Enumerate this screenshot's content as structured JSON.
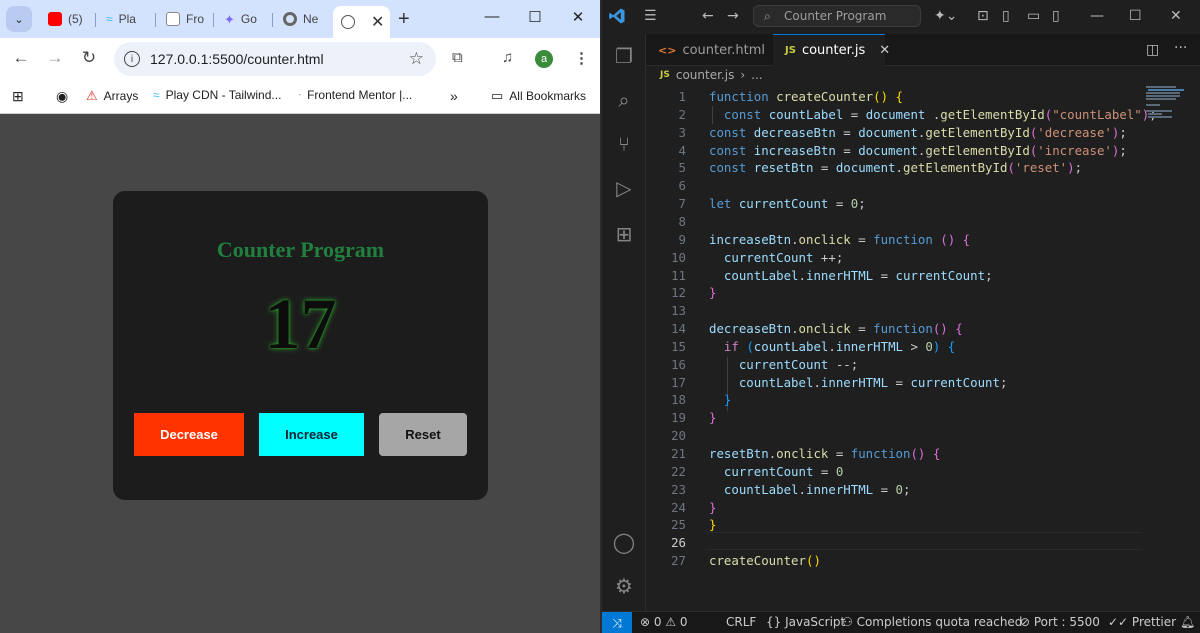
{
  "browser": {
    "tabs": [
      {
        "label": "(5)"
      },
      {
        "label": "Pla"
      },
      {
        "label": "Fro"
      },
      {
        "label": "Go"
      },
      {
        "label": "Ne"
      },
      {
        "label": ""
      }
    ],
    "url": "127.0.0.1:5500/counter.html",
    "avatar_letter": "a",
    "bookmarks": [
      "Arrays",
      "Play CDN - Tailwind...",
      "Frontend Mentor |...",
      "All Bookmarks"
    ],
    "overflow_label": "»"
  },
  "page": {
    "title": "Counter Program",
    "count": "17",
    "buttons": {
      "decrease": "Decrease",
      "increase": "Increase",
      "reset": "Reset"
    }
  },
  "vscode": {
    "search_placeholder": "Counter Program",
    "tabs": [
      {
        "icon": "<>",
        "label": "counter.html"
      },
      {
        "icon": "JS",
        "label": "counter.js"
      }
    ],
    "breadcrumb": {
      "icon": "JS",
      "file": "counter.js",
      "rest": "..."
    },
    "current_line": 26,
    "code_lines": [
      [
        [
          "kw",
          "function "
        ],
        [
          "fn",
          "createCounter"
        ],
        [
          "p1",
          "() {"
        ]
      ],
      [
        [
          "",
          "  "
        ],
        [
          "kw",
          "const "
        ],
        [
          "var",
          "countLabel"
        ],
        [
          "",
          " = "
        ],
        [
          "var",
          "document"
        ],
        [
          "",
          " ."
        ],
        [
          "fn",
          "getElementById"
        ],
        [
          "p2",
          "("
        ],
        [
          "str",
          "\"countLabel\""
        ],
        [
          "p2",
          ")"
        ],
        [
          "",
          ";"
        ]
      ],
      [
        [
          "kw",
          "const "
        ],
        [
          "var",
          "decreaseBtn"
        ],
        [
          "",
          " = "
        ],
        [
          "var",
          "document"
        ],
        [
          "",
          "."
        ],
        [
          "fn",
          "getElementById"
        ],
        [
          "p2",
          "("
        ],
        [
          "str",
          "'decrease'"
        ],
        [
          "p2",
          ")"
        ],
        [
          "",
          ";"
        ]
      ],
      [
        [
          "kw",
          "const "
        ],
        [
          "var",
          "increaseBtn"
        ],
        [
          "",
          " = "
        ],
        [
          "var",
          "document"
        ],
        [
          "",
          "."
        ],
        [
          "fn",
          "getElementById"
        ],
        [
          "p2",
          "("
        ],
        [
          "str",
          "'increase'"
        ],
        [
          "p2",
          ")"
        ],
        [
          "",
          ";"
        ]
      ],
      [
        [
          "kw",
          "const "
        ],
        [
          "var",
          "resetBtn"
        ],
        [
          "",
          " = "
        ],
        [
          "var",
          "document"
        ],
        [
          "",
          "."
        ],
        [
          "fn",
          "getElementById"
        ],
        [
          "p2",
          "("
        ],
        [
          "str",
          "'reset'"
        ],
        [
          "p2",
          ")"
        ],
        [
          "",
          ";"
        ]
      ],
      [],
      [
        [
          "kw",
          "let "
        ],
        [
          "var",
          "currentCount"
        ],
        [
          "",
          " = "
        ],
        [
          "num",
          "0"
        ],
        [
          "",
          ";"
        ]
      ],
      [],
      [
        [
          "var",
          "increaseBtn"
        ],
        [
          "",
          "."
        ],
        [
          "fn",
          "onclick"
        ],
        [
          "",
          " = "
        ],
        [
          "kw",
          "function "
        ],
        [
          "p2",
          "() {"
        ]
      ],
      [
        [
          "",
          "  "
        ],
        [
          "var",
          "currentCount"
        ],
        [
          "",
          " ++;"
        ]
      ],
      [
        [
          "",
          "  "
        ],
        [
          "var",
          "countLabel"
        ],
        [
          "",
          "."
        ],
        [
          "var",
          "innerHTML"
        ],
        [
          "",
          " = "
        ],
        [
          "var",
          "currentCount"
        ],
        [
          "",
          ";"
        ]
      ],
      [
        [
          "p2",
          "}"
        ]
      ],
      [],
      [
        [
          "var",
          "decreaseBtn"
        ],
        [
          "",
          "."
        ],
        [
          "fn",
          "onclick"
        ],
        [
          "",
          " = "
        ],
        [
          "kw",
          "function"
        ],
        [
          "p2",
          "() {"
        ]
      ],
      [
        [
          "",
          "  "
        ],
        [
          "ctl",
          "if "
        ],
        [
          "p3",
          "("
        ],
        [
          "var",
          "countLabel"
        ],
        [
          "",
          "."
        ],
        [
          "var",
          "innerHTML"
        ],
        [
          "",
          " > "
        ],
        [
          "num",
          "0"
        ],
        [
          "p3",
          ") {"
        ]
      ],
      [
        [
          "",
          "    "
        ],
        [
          "var",
          "currentCount"
        ],
        [
          "",
          " --;"
        ]
      ],
      [
        [
          "",
          "    "
        ],
        [
          "var",
          "countLabel"
        ],
        [
          "",
          "."
        ],
        [
          "var",
          "innerHTML"
        ],
        [
          "",
          " = "
        ],
        [
          "var",
          "currentCount"
        ],
        [
          "",
          ";"
        ]
      ],
      [
        [
          "",
          "  "
        ],
        [
          "p3",
          "}"
        ]
      ],
      [
        [
          "p2",
          "}"
        ]
      ],
      [],
      [
        [
          "var",
          "resetBtn"
        ],
        [
          "",
          "."
        ],
        [
          "fn",
          "onclick"
        ],
        [
          "",
          " = "
        ],
        [
          "kw",
          "function"
        ],
        [
          "p2",
          "() {"
        ]
      ],
      [
        [
          "",
          "  "
        ],
        [
          "var",
          "currentCount"
        ],
        [
          "",
          " = "
        ],
        [
          "num",
          "0"
        ]
      ],
      [
        [
          "",
          "  "
        ],
        [
          "var",
          "countLabel"
        ],
        [
          "",
          "."
        ],
        [
          "var",
          "innerHTML"
        ],
        [
          "",
          " = "
        ],
        [
          "num",
          "0"
        ],
        [
          "",
          ";"
        ]
      ],
      [
        [
          "p2",
          "}"
        ]
      ],
      [
        [
          "p1",
          "}"
        ]
      ],
      [],
      [
        [
          "fn",
          "createCounter"
        ],
        [
          "p1",
          "()"
        ]
      ]
    ],
    "status": {
      "problems": "⊗ 0 ⚠ 0",
      "eol": "CRLF",
      "language": "{} JavaScript",
      "completions": "Completions quota reached",
      "port": "Port : 5500",
      "formatter": "✓✓ Prettier"
    }
  }
}
